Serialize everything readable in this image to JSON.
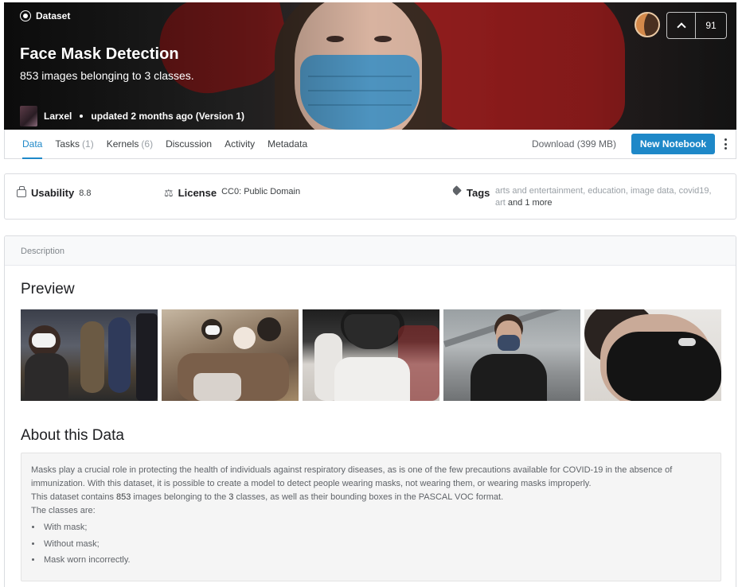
{
  "hero": {
    "type_label": "Dataset",
    "title": "Face Mask Detection",
    "subtitle": "853 images belonging to 3 classes.",
    "author": "Larxel",
    "updated": "updated 2 months ago (Version 1)",
    "vote_count": "91"
  },
  "tabs": [
    {
      "label": "Data",
      "count": "",
      "active": true
    },
    {
      "label": "Tasks",
      "count": "(1)"
    },
    {
      "label": "Kernels",
      "count": "(6)"
    },
    {
      "label": "Discussion",
      "count": ""
    },
    {
      "label": "Activity",
      "count": ""
    },
    {
      "label": "Metadata",
      "count": ""
    }
  ],
  "toolbar": {
    "download_label": "Download (399 MB)",
    "new_notebook_label": "New Notebook"
  },
  "info": {
    "usability_label": "Usability",
    "usability_value": "8.8",
    "license_label": "License",
    "license_value": "CC0: Public Domain",
    "tags_label": "Tags",
    "tags": [
      "arts and entertainment",
      "education",
      "image data",
      "covid19",
      "art"
    ],
    "tags_more": "and 1 more"
  },
  "description": {
    "header": "Description",
    "preview_title": "Preview",
    "about_title": "About this Data",
    "paragraph_1": "Masks play a crucial role in protecting the health of individuals against respiratory diseases, as is one of the few precautions available for COVID-19 in the absence of immunization. With this dataset, it is possible to create a model to detect people wearing masks, not wearing them, or wearing masks improperly.",
    "paragraph_2_a": "This dataset contains ",
    "paragraph_2_num": "853",
    "paragraph_2_b": " images belonging to the ",
    "paragraph_2_classes": "3",
    "paragraph_2_c": " classes, as well as their bounding boxes in the PASCAL VOC format.",
    "classes_intro": "The classes are:",
    "classes": [
      "With mask;",
      "Without mask;",
      "Mask worn incorrectly."
    ]
  },
  "colors": {
    "accent": "#1e88c8",
    "text": "#202124",
    "muted": "#9aa0a6"
  }
}
